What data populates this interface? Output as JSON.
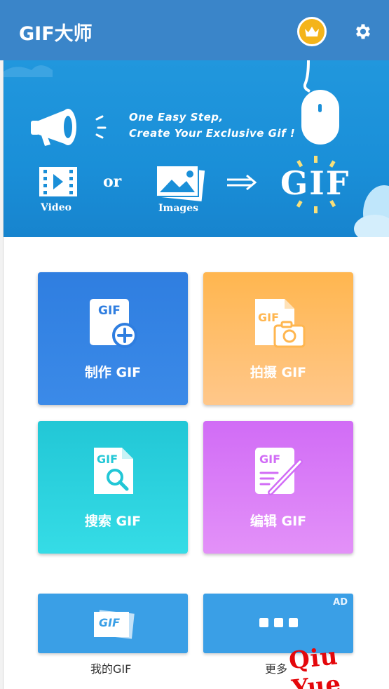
{
  "app_bar": {
    "title": "GIF大师",
    "accent": "#3a85c9"
  },
  "banner": {
    "tagline_line1": "One Easy Step,",
    "tagline_line2": "Create Your Exclusive Gif !",
    "video_caption": "Video",
    "or_text": "or",
    "images_caption": "Images",
    "gif_big_text": "GIF"
  },
  "tiles": {
    "make": {
      "label": "制作 GIF",
      "icon_text": "GIF",
      "color": "#2f7ee0"
    },
    "shoot": {
      "label": "拍摄 GIF",
      "icon_text": "GIF",
      "color": "#ffb64f"
    },
    "search": {
      "label": "搜索 GIF",
      "icon_text": "GIF",
      "color": "#22c7d6"
    },
    "edit": {
      "label": "编辑 GIF",
      "icon_text": "GIF",
      "color": "#d16cf6"
    }
  },
  "bottom": {
    "mine_label": "我的GIF",
    "mine_icon_text": "GIF",
    "more_label": "更多",
    "ad_tag": "AD"
  },
  "watermark": "Qiu  Yue"
}
